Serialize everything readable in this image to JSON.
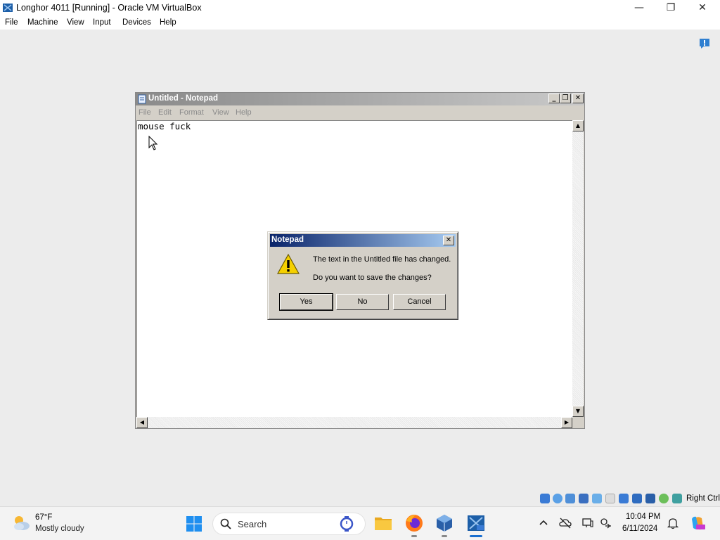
{
  "host": {
    "title": "Longhor 4011 [Running] - Oracle VM VirtualBox",
    "controls": {
      "minimize": "—",
      "maximize": "❐",
      "close": "✕"
    },
    "menu": [
      "File",
      "Machine",
      "View",
      "Input",
      "Devices",
      "Help"
    ]
  },
  "notepad": {
    "title": "Untitled - Notepad",
    "controls": {
      "minimize": "_",
      "restore": "❐",
      "close": "✕"
    },
    "menu": [
      "File",
      "Edit",
      "Format",
      "View",
      "Help"
    ],
    "content": "mouse fuck",
    "scroll_glyphs": {
      "up": "▲",
      "down": "▼",
      "left": "◀",
      "right": "▶"
    }
  },
  "dialog": {
    "title": "Notepad",
    "close_glyph": "✕",
    "message_line1": "The text in the Untitled file has changed.",
    "message_line2": "Do you want to save the changes?",
    "buttons": {
      "yes": "Yes",
      "no": "No",
      "cancel": "Cancel"
    }
  },
  "vbox_status": {
    "host_key": "Right Ctrl"
  },
  "taskbar": {
    "weather_temp": "67°F",
    "weather_condition": "Mostly cloudy",
    "search_label": "Search",
    "clock_time": "10:04 PM",
    "clock_date": "6/11/2024"
  },
  "colors": {
    "dialog_title_start": "#0a246a",
    "dialog_title_end": "#a6caf0",
    "inactive_title_start": "#8a8a8a",
    "classic_face": "#d4d0c8",
    "warning_yellow": "#f5d000"
  },
  "icons": {
    "host_app": "virtualbox-icon",
    "notification": "notification-icon",
    "notepad": "notepad-icon",
    "warning": "warning-icon",
    "weather": "partly-cloudy-icon",
    "start": "windows-start-icon",
    "search": "search-icon",
    "file_explorer": "folder-icon",
    "firefox": "firefox-icon",
    "virtualbox_manager": "virtualbox-manager-icon",
    "vm_running": "vm-longhorn-icon"
  }
}
